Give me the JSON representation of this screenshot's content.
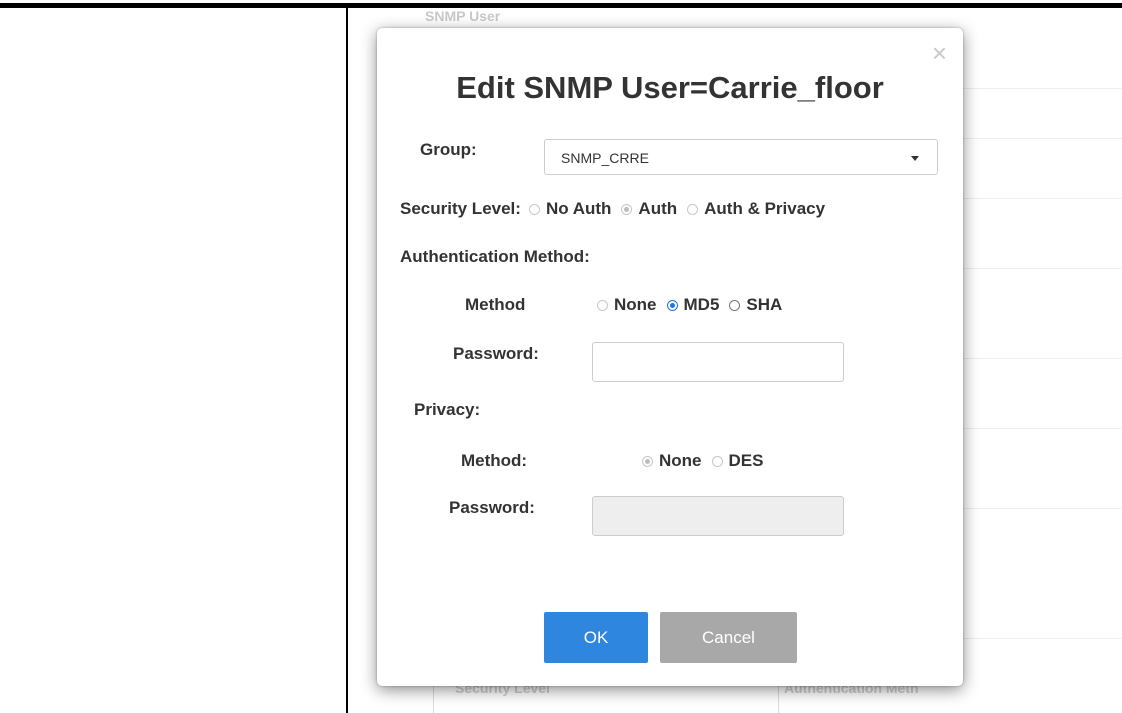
{
  "background": {
    "header_text": "SNMP User",
    "footer_col1": "Security Level",
    "footer_col2": "Authentication Meth"
  },
  "dialog": {
    "title": "Edit SNMP User=Carrie_floor",
    "close_glyph": "×",
    "group": {
      "label": "Group:",
      "value": "SNMP_CRRE"
    },
    "security_level": {
      "label": "Security Level:",
      "options": [
        "No Auth",
        "Auth",
        "Auth & Privacy"
      ],
      "selected": "Auth"
    },
    "authentication": {
      "section_label": "Authentication Method:",
      "method_label": "Method",
      "method_options": [
        "None",
        "MD5",
        "SHA"
      ],
      "method_selected": "MD5",
      "password_label": "Password:",
      "password_value": ""
    },
    "privacy": {
      "section_label": "Privacy:",
      "method_label": "Method:",
      "method_options": [
        "None",
        "DES"
      ],
      "method_selected": "None",
      "password_label": "Password:",
      "password_value": ""
    },
    "buttons": {
      "ok": "OK",
      "cancel": "Cancel"
    }
  },
  "colors": {
    "primary": "#2e86de",
    "secondary": "#a8a8a8",
    "text": "#333333"
  }
}
